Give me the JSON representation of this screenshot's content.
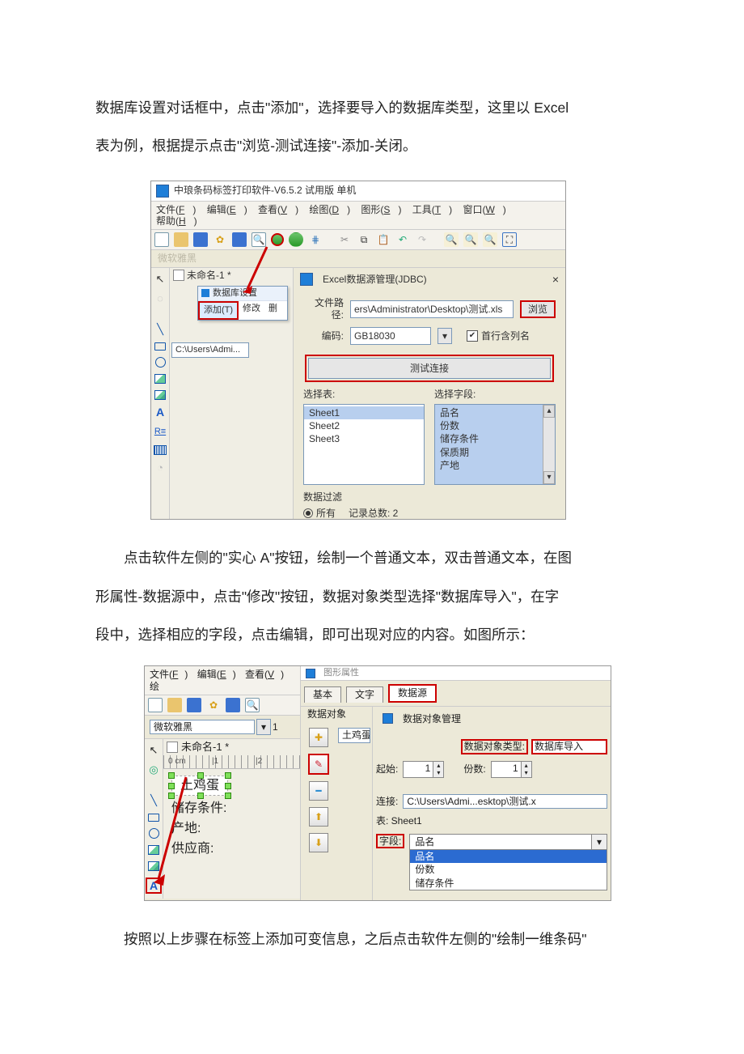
{
  "text": {
    "p1_l1": "数据库设置对话框中，点击\"添加\"，选择要导入的数据库类型，这里以 Excel",
    "p1_l2": "表为例，根据提示点击\"浏览-测试连接\"-添加-关闭。",
    "p2_l1": "点击软件左侧的\"实心 A\"按钮，绘制一个普通文本，双击普通文本，在图",
    "p2_l2": "形属性-数据源中，点击\"修改\"按钮，数据对象类型选择\"数据库导入\"，在字",
    "p2_l3": "段中，选择相应的字段，点击编辑，即可出现对应的内容。如图所示：",
    "p3_l1": "按照以上步骤在标签上添加可变信息，之后点击软件左侧的\"绘制一维条码\""
  },
  "s1": {
    "title": "中琅条码标签打印软件-V6.5.2 试用版 单机",
    "menus": {
      "file": "文件(F)",
      "edit": "编辑(E)",
      "view": "查看(V)",
      "draw": "绘图(D)",
      "graph": "图形(S)",
      "tool": "工具(T)",
      "window": "窗口(W)",
      "help": "帮助(H)"
    },
    "fontbar": "微软雅黑",
    "tabName": "未命名-1 *",
    "popup": {
      "head": "数据库设置",
      "add": "添加(T)",
      "mod": "修改",
      "del": "删"
    },
    "pathbox": "C:\\Users\\Admi...",
    "dlg": {
      "title": "Excel数据源管理(JDBC)",
      "close": "×",
      "pathLabel": "文件路径:",
      "pathValue": "ers\\Administrator\\Desktop\\测试.xls",
      "browse": "浏览",
      "encLabel": "编码:",
      "encValue": "GB18030",
      "firstRow": "首行含列名",
      "test": "测试连接",
      "selTable": "选择表:",
      "selField": "选择字段:",
      "sheets": [
        "Sheet1",
        "Sheet2",
        "Sheet3"
      ],
      "fields": [
        "品名",
        "份数",
        "储存条件",
        "保质期",
        "产地"
      ],
      "filter": "数据过滤",
      "all": "所有",
      "recTotal": "记录总数:  2"
    }
  },
  "s2": {
    "menus": {
      "file": "文件(F)",
      "edit": "编辑(E)",
      "view": "查看(V)",
      "draw": "绘"
    },
    "font": "微软雅黑",
    "fontSize": "1",
    "tabName": "未命名-1 *",
    "ruler": {
      "t0": "0 cm",
      "t1": "|1",
      "t2": "|2"
    },
    "canvas": {
      "text1": "土鸡蛋",
      "text2": "储存条件:",
      "text3": "产地:",
      "text4": "供应商:"
    },
    "dlgTitleFrag": "图形属性",
    "tabs": {
      "basic": "基本",
      "text": "文字",
      "data": "数据源"
    },
    "group": "数据对象",
    "item0": "土鸡蛋",
    "subhead": "数据对象管理",
    "typeLabel": "数据对象类型:",
    "typeValue": "数据库导入",
    "start": "起始:",
    "startVal": "1",
    "count": "份数:",
    "countVal": "1",
    "connLabel": "连接:",
    "connValue": "C:\\Users\\Admi...esktop\\测试.x",
    "tableLabel": "表: Sheet1",
    "fieldLabel": "字段:",
    "fieldSel": "品名",
    "fieldList": [
      "品名",
      "份数",
      "储存条件"
    ]
  }
}
